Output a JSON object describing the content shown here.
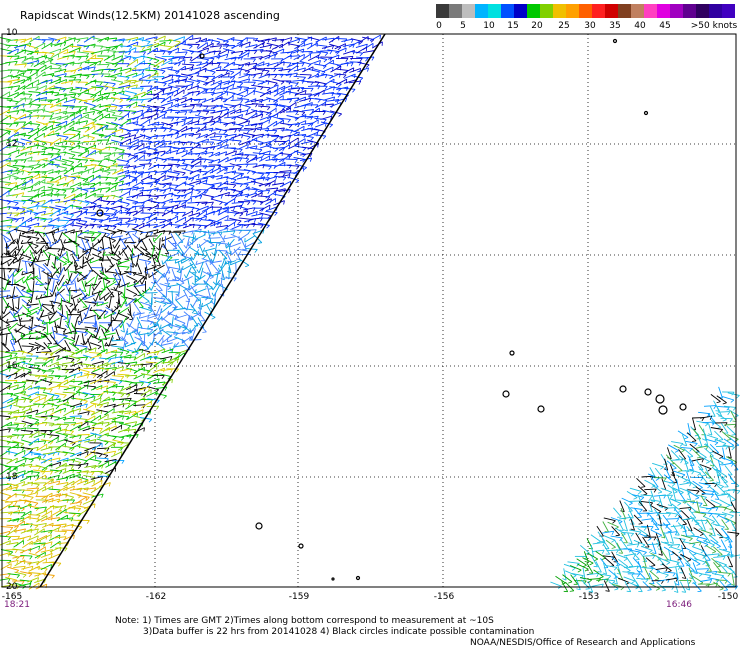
{
  "title": "Rapidscat Winds(12.5KM) 20141028 ascending",
  "legend": {
    "colors": [
      "#3a3a3a",
      "#7a7a7a",
      "#bdbdbd",
      "#00b4ff",
      "#00e0e0",
      "#0050ff",
      "#0000c8",
      "#00c800",
      "#80d000",
      "#f0c000",
      "#ffa000",
      "#ff6000",
      "#ff2020",
      "#d00000",
      "#804020",
      "#c08060",
      "#ff40c0",
      "#e000e0",
      "#a000c0",
      "#600090",
      "#300060",
      "#3000a0",
      "#4000c0"
    ],
    "labels": [
      "0",
      "5",
      "10",
      "15",
      "20",
      "25",
      "30",
      "35",
      "40",
      "45",
      ">50 knots"
    ]
  },
  "map": {
    "lat_labels": [
      "10",
      "12",
      "14",
      "16",
      "18",
      "20"
    ],
    "lon_labels": [
      "-165",
      "-162",
      "-159",
      "-156",
      "-153",
      "-150"
    ],
    "time_left": "18:21",
    "time_right": "16:46"
  },
  "notes": {
    "line1": "Note: 1) Times are GMT 2)Times along bottom correspond to measurement at ~10S",
    "line2": "3)Data buffer is 22 hrs from 20141028 4) Black circles indicate possible contamination",
    "credit": "NOAA/NESDIS/Office of Research and Applications"
  }
}
